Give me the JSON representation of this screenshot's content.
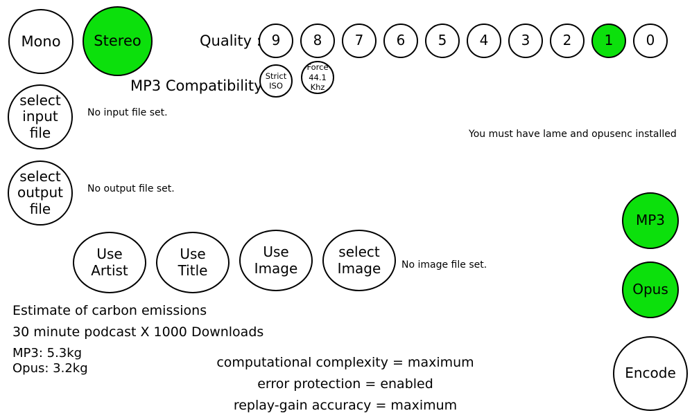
{
  "colors": {
    "selected": "#0ce00c",
    "unselected": "#ffffff",
    "outline": "#000000",
    "background": "#ffffff",
    "text": "#000000"
  },
  "channel_mode": {
    "mono": {
      "label": "Mono",
      "selected": false
    },
    "stereo": {
      "label": "Stereo",
      "selected": true
    }
  },
  "quality": {
    "label": "Quality :",
    "selected_value": "1",
    "options": [
      {
        "label": "9",
        "selected": false
      },
      {
        "label": "8",
        "selected": false
      },
      {
        "label": "7",
        "selected": false
      },
      {
        "label": "6",
        "selected": false
      },
      {
        "label": "5",
        "selected": false
      },
      {
        "label": "4",
        "selected": false
      },
      {
        "label": "3",
        "selected": false
      },
      {
        "label": "2",
        "selected": false
      },
      {
        "label": "1",
        "selected": true
      },
      {
        "label": "0",
        "selected": false
      }
    ]
  },
  "mp3_compatibility": {
    "label": "MP3 Compatibility:",
    "options": [
      {
        "line1": "Strict",
        "line2": "ISO",
        "line3": "",
        "selected": false
      },
      {
        "line1": "Force",
        "line2": "44.1",
        "line3": "Khz",
        "selected": false
      }
    ]
  },
  "files": {
    "input_button": {
      "line1": "select",
      "line2": "input",
      "line3": "file"
    },
    "input_status": "No input file set.",
    "output_button": {
      "line1": "select",
      "line2": "output",
      "line3": "file"
    },
    "output_status": "No output file set."
  },
  "dependency_warning": "You must have lame and opusenc installed",
  "tags": {
    "use_artist": {
      "line1": "Use",
      "line2": "Artist",
      "selected": false
    },
    "use_title": {
      "line1": "Use",
      "line2": "Title",
      "selected": false
    },
    "use_image": {
      "line1": "Use",
      "line2": "Image",
      "selected": false
    },
    "select_image": {
      "line1": "select",
      "line2": "Image",
      "selected": false
    },
    "image_status": "No image file set."
  },
  "emissions": {
    "heading": "Estimate of carbon emissions",
    "basis": "30 minute podcast X 1000 Downloads",
    "mp3": "MP3: 5.3kg",
    "opus": "Opus: 3.2kg"
  },
  "encoder_params": {
    "line1": "computational complexity = maximum",
    "line2": "error protection = enabled",
    "line3": "replay-gain accuracy = maximum"
  },
  "output_formats": {
    "mp3": {
      "label": "MP3",
      "selected": true
    },
    "opus": {
      "label": "Opus",
      "selected": true
    }
  },
  "encode_button": {
    "label": "Encode",
    "selected": false
  }
}
